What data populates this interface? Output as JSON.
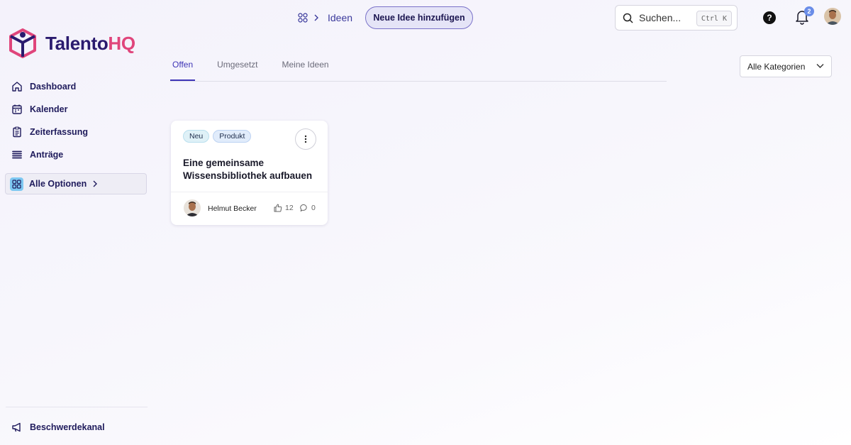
{
  "logo": {
    "part1": "Talento",
    "part2": "HQ"
  },
  "sidebar": {
    "items": [
      {
        "label": "Dashboard",
        "icon": "home-icon"
      },
      {
        "label": "Kalender",
        "icon": "calendar-icon"
      },
      {
        "label": "Zeiterfassung",
        "icon": "clipboard-icon"
      },
      {
        "label": "Anträge",
        "icon": "stack-icon"
      }
    ],
    "all_options": "Alle Optionen",
    "complaint": "Beschwerdekanal"
  },
  "breadcrumb": {
    "current": "Ideen"
  },
  "header": {
    "new_idea_button": "Neue Idee hinzufügen",
    "search_placeholder": "Suchen...",
    "search_shortcut": "Ctrl K",
    "notifications_count": "2"
  },
  "tabs": [
    {
      "label": "Offen",
      "active": true
    },
    {
      "label": "Umgesetzt",
      "active": false
    },
    {
      "label": "Meine Ideen",
      "active": false
    }
  ],
  "category_filter": {
    "selected": "Alle Kategorien"
  },
  "ideas": [
    {
      "tags": [
        "Neu",
        "Produkt"
      ],
      "title": "Eine gemeinsame Wissensbibliothek aufbauen",
      "author": "Helmut Becker",
      "likes": "12",
      "comments": "0"
    }
  ],
  "colors": {
    "brand_dark": "#2a1a6e",
    "brand_pink": "#e0457b",
    "accent": "#3e35b6"
  }
}
